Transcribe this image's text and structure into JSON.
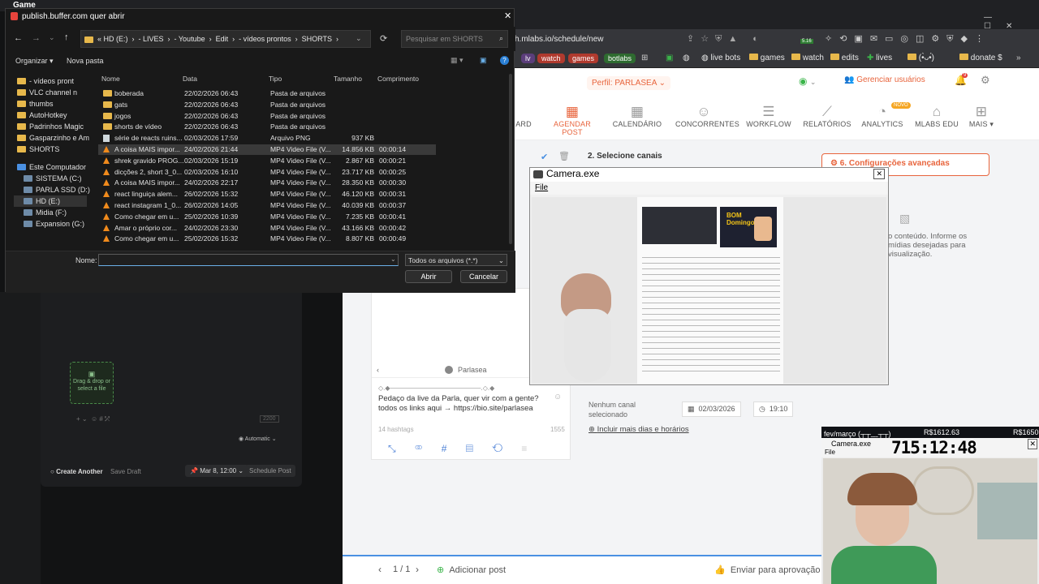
{
  "topbar": {
    "app_name": "Game"
  },
  "dialog": {
    "title": "publish.buffer.com quer abrir",
    "path": [
      "HD (E:)",
      "LIVES",
      "Youtube",
      "Edit",
      "vídeos prontos",
      "SHORTS"
    ],
    "search_placeholder": "Pesquisar em SHORTS",
    "organize": "Organizar",
    "new_folder": "Nova pasta",
    "columns": {
      "name": "Nome",
      "date": "Data",
      "type": "Tipo",
      "size": "Tamanho",
      "length": "Comprimento"
    },
    "sidebar": [
      {
        "label": "- vídeos pront",
        "kind": "folder"
      },
      {
        "label": "VLC channel n",
        "kind": "folder"
      },
      {
        "label": "thumbs",
        "kind": "folder"
      },
      {
        "label": "AutoHotkey",
        "kind": "folder"
      },
      {
        "label": "Padrinhos Magic",
        "kind": "folder"
      },
      {
        "label": "Gasparzinho e Am",
        "kind": "folder"
      },
      {
        "label": "SHORTS",
        "kind": "folder"
      },
      {
        "label": "Este Computador",
        "kind": "pc"
      },
      {
        "label": "SISTEMA (C:)",
        "kind": "drive"
      },
      {
        "label": "PARLA SSD (D:)",
        "kind": "drive"
      },
      {
        "label": "HD (E:)",
        "kind": "drive"
      },
      {
        "label": "Midia (F:)",
        "kind": "drive"
      },
      {
        "label": "Expansion (G:)",
        "kind": "drive"
      }
    ],
    "files": [
      {
        "name": "boberada",
        "date": "22/02/2026 06:43",
        "type": "Pasta de arquivos",
        "size": "",
        "length": "",
        "kind": "folder"
      },
      {
        "name": "gats",
        "date": "22/02/2026 06:43",
        "type": "Pasta de arquivos",
        "size": "",
        "length": "",
        "kind": "folder"
      },
      {
        "name": "jogos",
        "date": "22/02/2026 06:43",
        "type": "Pasta de arquivos",
        "size": "",
        "length": "",
        "kind": "folder"
      },
      {
        "name": "shorts de vídeo",
        "date": "22/02/2026 06:43",
        "type": "Pasta de arquivos",
        "size": "",
        "length": "",
        "kind": "folder"
      },
      {
        "name": "série de reacts ruins...",
        "date": "02/03/2026 17:59",
        "type": "Arquivo PNG",
        "size": "937 KB",
        "length": "",
        "kind": "png"
      },
      {
        "name": "A coisa MAIS impor...",
        "date": "24/02/2026 21:44",
        "type": "MP4 Video File (V...",
        "size": "14.856 KB",
        "length": "00:00:14",
        "kind": "vlc"
      },
      {
        "name": "shrek gravido PROG...",
        "date": "02/03/2026 15:19",
        "type": "MP4 Video File (V...",
        "size": "2.867 KB",
        "length": "00:00:21",
        "kind": "vlc"
      },
      {
        "name": "dicções 2, short 3_0...",
        "date": "02/03/2026 16:10",
        "type": "MP4 Video File (V...",
        "size": "23.717 KB",
        "length": "00:00:25",
        "kind": "vlc"
      },
      {
        "name": "A coisa MAIS impor...",
        "date": "24/02/2026 22:17",
        "type": "MP4 Video File (V...",
        "size": "28.350 KB",
        "length": "00:00:30",
        "kind": "vlc"
      },
      {
        "name": "react linguiça alem...",
        "date": "26/02/2026 15:32",
        "type": "MP4 Video File (V...",
        "size": "46.120 KB",
        "length": "00:00:31",
        "kind": "vlc"
      },
      {
        "name": "react instagram 1_0...",
        "date": "26/02/2026 14:05",
        "type": "MP4 Video File (V...",
        "size": "40.039 KB",
        "length": "00:00:37",
        "kind": "vlc"
      },
      {
        "name": "Como chegar em u...",
        "date": "25/02/2026 10:39",
        "type": "MP4 Video File (V...",
        "size": "7.235 KB",
        "length": "00:00:41",
        "kind": "vlc"
      },
      {
        "name": "Amar o próprio cor...",
        "date": "24/02/2026 23:30",
        "type": "MP4 Video File (V...",
        "size": "43.166 KB",
        "length": "00:00:42",
        "kind": "vlc"
      },
      {
        "name": "Como chegar em u...",
        "date": "25/02/2026 15:32",
        "type": "MP4 Video File (V...",
        "size": "8.807 KB",
        "length": "00:00:49",
        "kind": "vlc"
      }
    ],
    "filename_label": "Nome:",
    "filename_value": "",
    "filter": "Todos os arquivos (*.*)",
    "open": "Abrir",
    "cancel": "Cancelar"
  },
  "browser": {
    "url": "h.mlabs.io/schedule/new",
    "bookmarks": [
      {
        "label": "lv",
        "color": "#7b5a9e"
      },
      {
        "label": "watch",
        "color": "#c0392b"
      },
      {
        "label": "games",
        "color": "#c0392b"
      },
      {
        "label": "botlabs",
        "color": "#2e7d32"
      },
      {
        "label": "live bots",
        "color": ""
      },
      {
        "label": "games",
        "color": ""
      },
      {
        "label": "watch",
        "color": ""
      },
      {
        "label": "edits",
        "color": ""
      },
      {
        "label": "lives",
        "color": ""
      },
      {
        "label": "(•̀ᴗ•́)",
        "color": ""
      },
      {
        "label": "donate $",
        "color": ""
      }
    ],
    "badge_count": "5.16"
  },
  "mlabs": {
    "profile": "Perfil: PARLASEA",
    "manage_users": "Gerenciar usuários",
    "bell_count": "9",
    "nav": [
      {
        "label": "ARD",
        "active": false
      },
      {
        "label": "AGENDAR POST",
        "active": true
      },
      {
        "label": "CALENDÁRIO",
        "active": false
      },
      {
        "label": "CONCORRENTES",
        "active": false
      },
      {
        "label": "WORKFLOW",
        "active": false
      },
      {
        "label": "RELATÓRIOS",
        "active": false
      },
      {
        "label": "ANALYTICS",
        "active": false
      },
      {
        "label": "MLABS EDU",
        "active": false
      },
      {
        "label": "MAIS ▾",
        "active": false
      }
    ],
    "analytics_badge": "NOVO",
    "step2": "2. Selecione canais",
    "step6": "6. Configurações avançadas",
    "content_hint": "o conteúdo. Informe os\nmídias desejadas para\nvisualização.",
    "preview_name": "Parlasea",
    "post_dots": "◇.◆——————————————.◇.◆",
    "post_text": "Pedaço da live da Parla, quer vir com a gente? todos os links aqui → https://bio.site/parlasea",
    "hashtags": "14 hashtags",
    "char_count": "1555",
    "no_channel": "Nenhum canal selecionado",
    "date": "02/03/2026",
    "time": "19:10",
    "add_more": "Incluir mais dias e horários",
    "pager": "1 / 1",
    "add_post": "Adicionar post",
    "send_approval": "Enviar para aprovação"
  },
  "buffer": {
    "drag_drop": "Drag & drop or select a file",
    "automatic": "Automatic",
    "create_another": "Create Another",
    "save_draft": "Save Draft",
    "date": "Mar 8, 12:00",
    "schedule": "Schedule Post",
    "char_limit": "2200"
  },
  "camera": {
    "title": "Camera.exe",
    "menu": "File",
    "doc_badge": "BOM Domingo"
  },
  "counter": {
    "label": "fev/março (┬┬﹏┬┬)",
    "amount1": "R$1612.63",
    "amount2": "R$1650"
  },
  "camera2": {
    "title": "Camera.exe",
    "menu": "File",
    "timer": "715:12:48"
  }
}
